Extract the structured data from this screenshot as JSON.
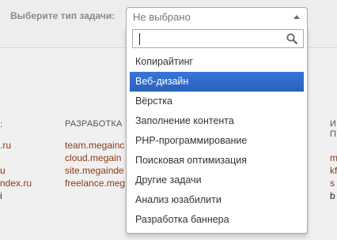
{
  "task_filter": {
    "label": "Выберите тип задачи:",
    "selected": "Не выбрано",
    "search_value": "",
    "options": [
      "Копирайтинг",
      "Веб-дизайн",
      "Вёрстка",
      "Заполнение контента",
      "PHP-программирование",
      "Поисковая оптимизация",
      "Другие задачи",
      "Анализ юзабилити",
      "Разработка баннера"
    ],
    "highlighted": "Веб-дизайн"
  },
  "footer": {
    "col1": {
      "head": ":",
      "links": [
        ".ru",
        "",
        "u",
        "ndex.ru",
        "i"
      ]
    },
    "col2": {
      "head": "РАЗРАБОТКА",
      "links": [
        "team.megainc",
        "cloud.megain",
        "site.megainde",
        "freelance.meg"
      ]
    },
    "col3": {
      "head": [
        "И",
        "П"
      ],
      "links": [
        "m",
        "kf",
        "s",
        "b"
      ]
    }
  },
  "colors": {
    "highlight": "#3875d7",
    "link": "#8b3a17"
  }
}
